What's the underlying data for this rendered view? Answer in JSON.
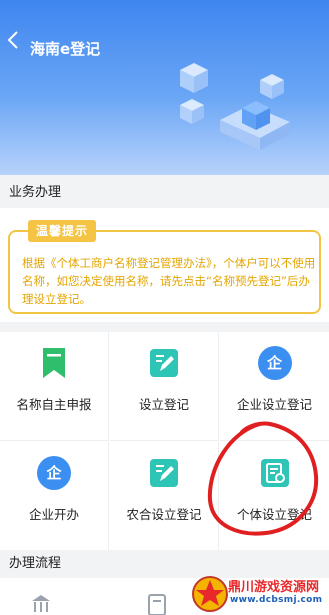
{
  "header": {
    "title": "海南e登记"
  },
  "sections": {
    "business": "业务办理",
    "process": "办理流程"
  },
  "notice": {
    "tag": "温馨提示",
    "text": "根据《个体工商户名称登记管理办法》，个体户可以不使用名称，如您决定使用名称，请先点击“名称预先登记”后办理设立登记。"
  },
  "services": [
    {
      "label": "名称自主申报",
      "icon": "bookmark-icon",
      "color": "#2fbe6b"
    },
    {
      "label": "设立登记",
      "icon": "edit-icon",
      "color": "#2ec4b6"
    },
    {
      "label": "企业设立登记",
      "icon": "qi-icon",
      "icon_text": "企",
      "color": "#3b8ff1"
    },
    {
      "label": "企业开办",
      "icon": "qi-icon",
      "icon_text": "企",
      "color": "#3b8ff1"
    },
    {
      "label": "农合设立登记",
      "icon": "edit-icon",
      "color": "#2ec4b6"
    },
    {
      "label": "个体设立登记",
      "icon": "document-icon",
      "color": "#2ec4b6"
    }
  ],
  "watermark": {
    "title": "鼎川游戏资源网",
    "url": "www.dcbsmj.com"
  },
  "colors": {
    "header": "#3f86f0",
    "notice": "#f3c545",
    "annotation": "#e02020"
  }
}
